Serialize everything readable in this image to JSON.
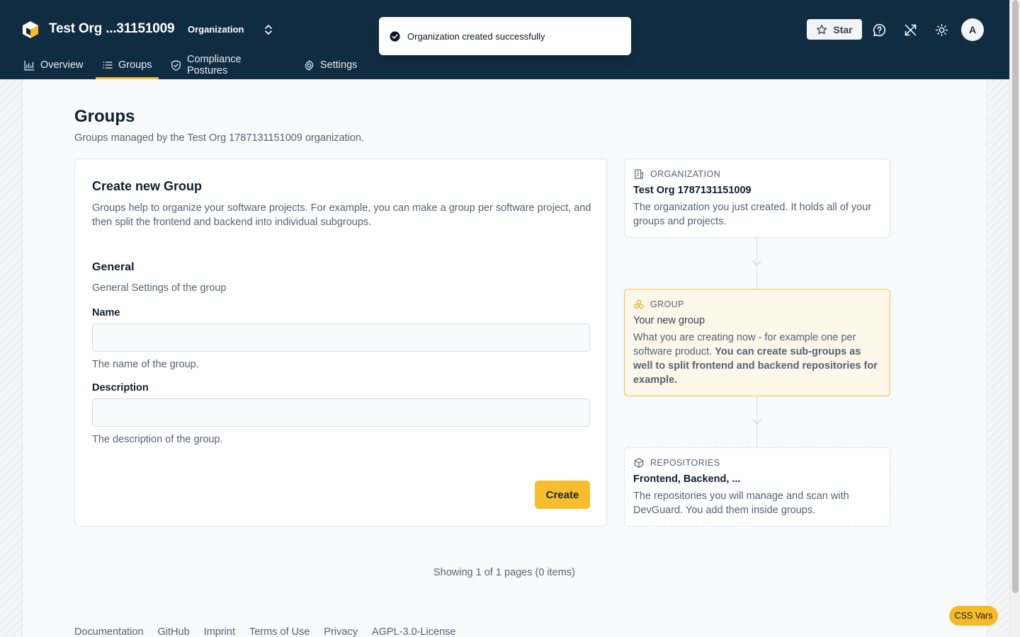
{
  "header": {
    "org_title": "Test Org ...31151009",
    "org_type": "Organization",
    "star_label": "Star",
    "avatar_initial": "A"
  },
  "tabs": [
    {
      "label": "Overview",
      "icon": "chart-icon"
    },
    {
      "label": "Groups",
      "icon": "list-icon",
      "active": true
    },
    {
      "label": "Compliance Postures",
      "icon": "shield-icon"
    },
    {
      "label": "Settings",
      "icon": "gear-icon"
    }
  ],
  "toast": {
    "message": "Organization created successfully",
    "icon": "check-circle-icon"
  },
  "page": {
    "title": "Groups",
    "subtitle": "Groups managed by the Test Org 1787131151009 organization."
  },
  "form": {
    "title": "Create new Group",
    "description": "Groups help to organize your software projects. For example, you can make a group per software project, and then split the frontend and backend into individual subgroups.",
    "section_title": "General",
    "section_subtitle": "General Settings of the group",
    "name_label": "Name",
    "name_value": "",
    "name_hint": "The name of the group.",
    "description_label": "Description",
    "description_value": "",
    "description_hint": "The description of the group.",
    "create_label": "Create"
  },
  "timeline": {
    "organization": {
      "kicker": "ORGANIZATION",
      "title": "Test Org 1787131151009",
      "text": "The organization you just created. It holds all of your groups and projects."
    },
    "group": {
      "kicker": "GROUP",
      "title": "Your new group",
      "text": "What you are creating now - for example one per software product.",
      "text_bold": "You can create sub-groups as well to split frontend and backend repositories for example."
    },
    "repositories": {
      "kicker": "REPOSITORIES",
      "title": "Frontend, Backend, ...",
      "text": "The repositories you will manage and scan with DevGuard. You add them inside groups."
    }
  },
  "pager": "Showing 1 of 1 pages (0 items)",
  "footer": [
    "Documentation",
    "GitHub",
    "Imprint",
    "Terms of Use",
    "Privacy",
    "AGPL-3.0-License"
  ],
  "css_vars_label": "CSS Vars",
  "colors": {
    "header_bg": "#0f2c40",
    "accent": "#f6be2c",
    "highlight_bg": "#fdf7ea"
  }
}
